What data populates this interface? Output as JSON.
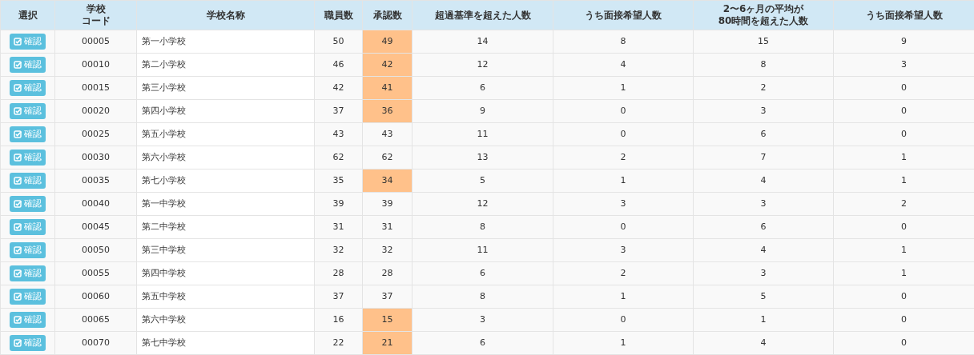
{
  "table": {
    "columns": [
      [
        "選択"
      ],
      [
        "学校",
        "コード"
      ],
      [
        "学校名称"
      ],
      [
        "職員数"
      ],
      [
        "承認数"
      ],
      [
        "超過基準を超えた人数"
      ],
      [
        "うち面接希望人数"
      ],
      [
        "2〜6ヶ月の平均が",
        "80時間を超えた人数"
      ],
      [
        "うち面接希望人数"
      ]
    ],
    "rows": [
      {
        "button": "確認",
        "code": "00005",
        "name": "第一小学校",
        "staff": "50",
        "approved": "49",
        "flagged": true,
        "over": "14",
        "interview": "8",
        "avg_over": "15",
        "interview_2": "9"
      },
      {
        "button": "確認",
        "code": "00010",
        "name": "第二小学校",
        "staff": "46",
        "approved": "42",
        "flagged": true,
        "over": "12",
        "interview": "4",
        "avg_over": "8",
        "interview_2": "3"
      },
      {
        "button": "確認",
        "code": "00015",
        "name": "第三小学校",
        "staff": "42",
        "approved": "41",
        "flagged": true,
        "over": "6",
        "interview": "1",
        "avg_over": "2",
        "interview_2": "0"
      },
      {
        "button": "確認",
        "code": "00020",
        "name": "第四小学校",
        "staff": "37",
        "approved": "36",
        "flagged": true,
        "over": "9",
        "interview": "0",
        "avg_over": "3",
        "interview_2": "0"
      },
      {
        "button": "確認",
        "code": "00025",
        "name": "第五小学校",
        "staff": "43",
        "approved": "43",
        "flagged": false,
        "over": "11",
        "interview": "0",
        "avg_over": "6",
        "interview_2": "0"
      },
      {
        "button": "確認",
        "code": "00030",
        "name": "第六小学校",
        "staff": "62",
        "approved": "62",
        "flagged": false,
        "over": "13",
        "interview": "2",
        "avg_over": "7",
        "interview_2": "1"
      },
      {
        "button": "確認",
        "code": "00035",
        "name": "第七小学校",
        "staff": "35",
        "approved": "34",
        "flagged": true,
        "over": "5",
        "interview": "1",
        "avg_over": "4",
        "interview_2": "1"
      },
      {
        "button": "確認",
        "code": "00040",
        "name": "第一中学校",
        "staff": "39",
        "approved": "39",
        "flagged": false,
        "over": "12",
        "interview": "3",
        "avg_over": "3",
        "interview_2": "2"
      },
      {
        "button": "確認",
        "code": "00045",
        "name": "第二中学校",
        "staff": "31",
        "approved": "31",
        "flagged": false,
        "over": "8",
        "interview": "0",
        "avg_over": "6",
        "interview_2": "0"
      },
      {
        "button": "確認",
        "code": "00050",
        "name": "第三中学校",
        "staff": "32",
        "approved": "32",
        "flagged": false,
        "over": "11",
        "interview": "3",
        "avg_over": "4",
        "interview_2": "1"
      },
      {
        "button": "確認",
        "code": "00055",
        "name": "第四中学校",
        "staff": "28",
        "approved": "28",
        "flagged": false,
        "over": "6",
        "interview": "2",
        "avg_over": "3",
        "interview_2": "1"
      },
      {
        "button": "確認",
        "code": "00060",
        "name": "第五中学校",
        "staff": "37",
        "approved": "37",
        "flagged": false,
        "over": "8",
        "interview": "1",
        "avg_over": "5",
        "interview_2": "0"
      },
      {
        "button": "確認",
        "code": "00065",
        "name": "第六中学校",
        "staff": "16",
        "approved": "15",
        "flagged": true,
        "over": "3",
        "interview": "0",
        "avg_over": "1",
        "interview_2": "0"
      },
      {
        "button": "確認",
        "code": "00070",
        "name": "第七中学校",
        "staff": "22",
        "approved": "21",
        "flagged": true,
        "over": "6",
        "interview": "1",
        "avg_over": "4",
        "interview_2": "0"
      }
    ]
  }
}
